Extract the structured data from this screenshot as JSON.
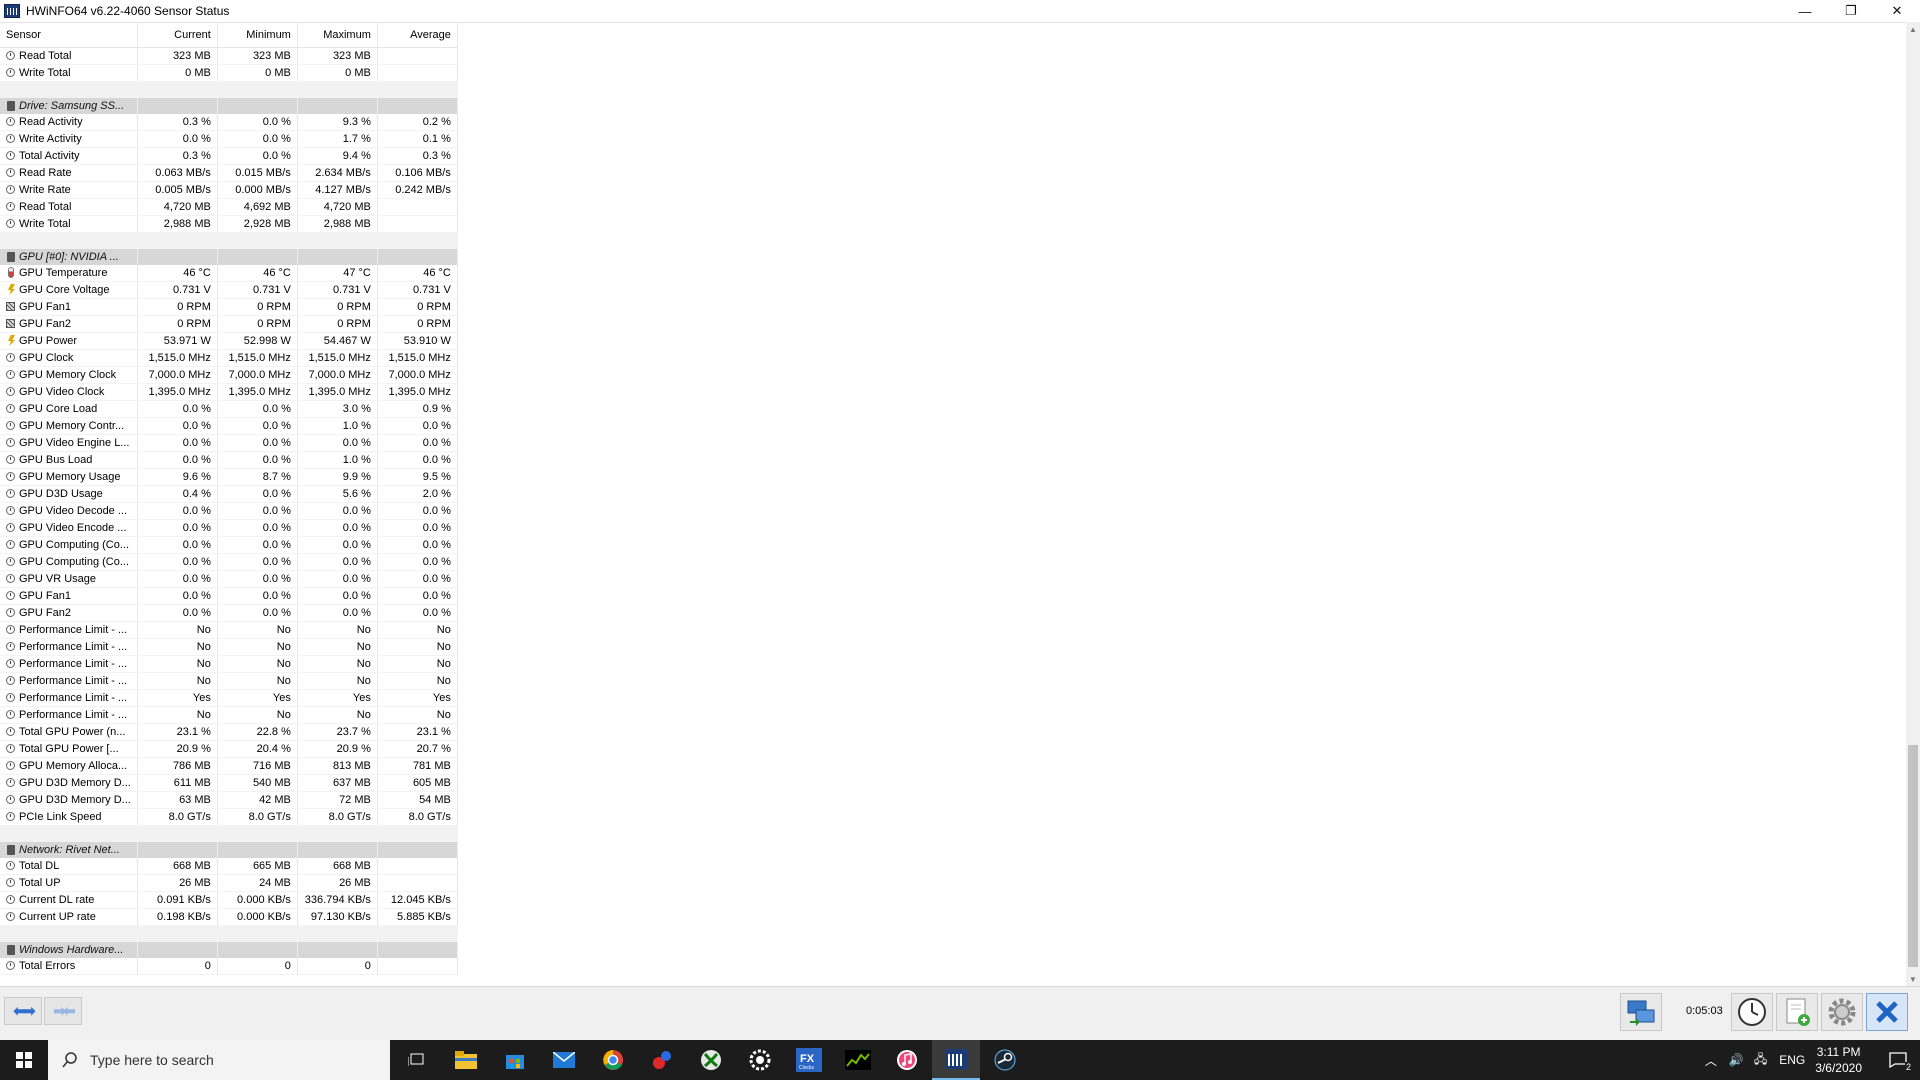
{
  "window": {
    "title": "HWiNFO64 v6.22-4060 Sensor Status",
    "minimize": "—",
    "restore": "❐",
    "close": "✕"
  },
  "columns": [
    "Sensor",
    "Current",
    "Minimum",
    "Maximum",
    "Average"
  ],
  "rows": [
    {
      "type": "sensor",
      "icon": "clock",
      "name": "Read Total",
      "cur": "323 MB",
      "min": "323 MB",
      "max": "323 MB",
      "avg": ""
    },
    {
      "type": "sensor",
      "icon": "clock",
      "name": "Write Total",
      "cur": "0 MB",
      "min": "0 MB",
      "max": "0 MB",
      "avg": ""
    },
    {
      "type": "blank"
    },
    {
      "type": "group",
      "icon": "drive",
      "name": "Drive: Samsung SS..."
    },
    {
      "type": "sensor",
      "icon": "clock",
      "name": "Read Activity",
      "cur": "0.3 %",
      "min": "0.0 %",
      "max": "9.3 %",
      "avg": "0.2 %"
    },
    {
      "type": "sensor",
      "icon": "clock",
      "name": "Write Activity",
      "cur": "0.0 %",
      "min": "0.0 %",
      "max": "1.7 %",
      "avg": "0.1 %"
    },
    {
      "type": "sensor",
      "icon": "clock",
      "name": "Total Activity",
      "cur": "0.3 %",
      "min": "0.0 %",
      "max": "9.4 %",
      "avg": "0.3 %"
    },
    {
      "type": "sensor",
      "icon": "clock",
      "name": "Read Rate",
      "cur": "0.063 MB/s",
      "min": "0.015 MB/s",
      "max": "2.634 MB/s",
      "avg": "0.106 MB/s"
    },
    {
      "type": "sensor",
      "icon": "clock",
      "name": "Write Rate",
      "cur": "0.005 MB/s",
      "min": "0.000 MB/s",
      "max": "4.127 MB/s",
      "avg": "0.242 MB/s"
    },
    {
      "type": "sensor",
      "icon": "clock",
      "name": "Read Total",
      "cur": "4,720 MB",
      "min": "4,692 MB",
      "max": "4,720 MB",
      "avg": ""
    },
    {
      "type": "sensor",
      "icon": "clock",
      "name": "Write Total",
      "cur": "2,988 MB",
      "min": "2,928 MB",
      "max": "2,988 MB",
      "avg": ""
    },
    {
      "type": "blank"
    },
    {
      "type": "group",
      "icon": "drive",
      "name": "GPU [#0]: NVIDIA ..."
    },
    {
      "type": "sensor",
      "icon": "therm",
      "name": "GPU Temperature",
      "cur": "46 °C",
      "min": "46 °C",
      "max": "47 °C",
      "avg": "46 °C"
    },
    {
      "type": "sensor",
      "icon": "bolt",
      "name": "GPU Core Voltage",
      "cur": "0.731 V",
      "min": "0.731 V",
      "max": "0.731 V",
      "avg": "0.731 V"
    },
    {
      "type": "sensor",
      "icon": "fan",
      "name": "GPU Fan1",
      "cur": "0 RPM",
      "min": "0 RPM",
      "max": "0 RPM",
      "avg": "0 RPM"
    },
    {
      "type": "sensor",
      "icon": "fan",
      "name": "GPU Fan2",
      "cur": "0 RPM",
      "min": "0 RPM",
      "max": "0 RPM",
      "avg": "0 RPM"
    },
    {
      "type": "sensor",
      "icon": "bolt",
      "name": "GPU Power",
      "cur": "53.971 W",
      "min": "52.998 W",
      "max": "54.467 W",
      "avg": "53.910 W"
    },
    {
      "type": "sensor",
      "icon": "clock",
      "name": "GPU Clock",
      "cur": "1,515.0 MHz",
      "min": "1,515.0 MHz",
      "max": "1,515.0 MHz",
      "avg": "1,515.0 MHz"
    },
    {
      "type": "sensor",
      "icon": "clock",
      "name": "GPU Memory Clock",
      "cur": "7,000.0 MHz",
      "min": "7,000.0 MHz",
      "max": "7,000.0 MHz",
      "avg": "7,000.0 MHz"
    },
    {
      "type": "sensor",
      "icon": "clock",
      "name": "GPU Video Clock",
      "cur": "1,395.0 MHz",
      "min": "1,395.0 MHz",
      "max": "1,395.0 MHz",
      "avg": "1,395.0 MHz"
    },
    {
      "type": "sensor",
      "icon": "clock",
      "name": "GPU Core Load",
      "cur": "0.0 %",
      "min": "0.0 %",
      "max": "3.0 %",
      "avg": "0.9 %"
    },
    {
      "type": "sensor",
      "icon": "clock",
      "name": "GPU Memory Contr...",
      "cur": "0.0 %",
      "min": "0.0 %",
      "max": "1.0 %",
      "avg": "0.0 %"
    },
    {
      "type": "sensor",
      "icon": "clock",
      "name": "GPU Video Engine L...",
      "cur": "0.0 %",
      "min": "0.0 %",
      "max": "0.0 %",
      "avg": "0.0 %"
    },
    {
      "type": "sensor",
      "icon": "clock",
      "name": "GPU Bus Load",
      "cur": "0.0 %",
      "min": "0.0 %",
      "max": "1.0 %",
      "avg": "0.0 %"
    },
    {
      "type": "sensor",
      "icon": "clock",
      "name": "GPU Memory Usage",
      "cur": "9.6 %",
      "min": "8.7 %",
      "max": "9.9 %",
      "avg": "9.5 %"
    },
    {
      "type": "sensor",
      "icon": "clock",
      "name": "GPU D3D Usage",
      "cur": "0.4 %",
      "min": "0.0 %",
      "max": "5.6 %",
      "avg": "2.0 %"
    },
    {
      "type": "sensor",
      "icon": "clock",
      "name": "GPU Video Decode ...",
      "cur": "0.0 %",
      "min": "0.0 %",
      "max": "0.0 %",
      "avg": "0.0 %"
    },
    {
      "type": "sensor",
      "icon": "clock",
      "name": "GPU Video Encode ...",
      "cur": "0.0 %",
      "min": "0.0 %",
      "max": "0.0 %",
      "avg": "0.0 %"
    },
    {
      "type": "sensor",
      "icon": "clock",
      "name": "GPU Computing (Co...",
      "cur": "0.0 %",
      "min": "0.0 %",
      "max": "0.0 %",
      "avg": "0.0 %"
    },
    {
      "type": "sensor",
      "icon": "clock",
      "name": "GPU Computing (Co...",
      "cur": "0.0 %",
      "min": "0.0 %",
      "max": "0.0 %",
      "avg": "0.0 %"
    },
    {
      "type": "sensor",
      "icon": "clock",
      "name": "GPU VR Usage",
      "cur": "0.0 %",
      "min": "0.0 %",
      "max": "0.0 %",
      "avg": "0.0 %"
    },
    {
      "type": "sensor",
      "icon": "clock",
      "name": "GPU Fan1",
      "cur": "0.0 %",
      "min": "0.0 %",
      "max": "0.0 %",
      "avg": "0.0 %"
    },
    {
      "type": "sensor",
      "icon": "clock",
      "name": "GPU Fan2",
      "cur": "0.0 %",
      "min": "0.0 %",
      "max": "0.0 %",
      "avg": "0.0 %"
    },
    {
      "type": "sensor",
      "icon": "clock",
      "name": "Performance Limit - ...",
      "cur": "No",
      "min": "No",
      "max": "No",
      "avg": "No"
    },
    {
      "type": "sensor",
      "icon": "clock",
      "name": "Performance Limit - ...",
      "cur": "No",
      "min": "No",
      "max": "No",
      "avg": "No"
    },
    {
      "type": "sensor",
      "icon": "clock",
      "name": "Performance Limit - ...",
      "cur": "No",
      "min": "No",
      "max": "No",
      "avg": "No"
    },
    {
      "type": "sensor",
      "icon": "clock",
      "name": "Performance Limit - ...",
      "cur": "No",
      "min": "No",
      "max": "No",
      "avg": "No"
    },
    {
      "type": "sensor",
      "icon": "clock",
      "name": "Performance Limit - ...",
      "cur": "Yes",
      "min": "Yes",
      "max": "Yes",
      "avg": "Yes"
    },
    {
      "type": "sensor",
      "icon": "clock",
      "name": "Performance Limit - ...",
      "cur": "No",
      "min": "No",
      "max": "No",
      "avg": "No"
    },
    {
      "type": "sensor",
      "icon": "clock",
      "name": "Total GPU Power (n...",
      "cur": "23.1 %",
      "min": "22.8 %",
      "max": "23.7 %",
      "avg": "23.1 %"
    },
    {
      "type": "sensor",
      "icon": "clock",
      "name": "Total GPU Power [...",
      "cur": "20.9 %",
      "min": "20.4 %",
      "max": "20.9 %",
      "avg": "20.7 %"
    },
    {
      "type": "sensor",
      "icon": "clock",
      "name": "GPU Memory Alloca...",
      "cur": "786 MB",
      "min": "716 MB",
      "max": "813 MB",
      "avg": "781 MB"
    },
    {
      "type": "sensor",
      "icon": "clock",
      "name": "GPU D3D Memory D...",
      "cur": "611 MB",
      "min": "540 MB",
      "max": "637 MB",
      "avg": "605 MB"
    },
    {
      "type": "sensor",
      "icon": "clock",
      "name": "GPU D3D Memory D...",
      "cur": "63 MB",
      "min": "42 MB",
      "max": "72 MB",
      "avg": "54 MB"
    },
    {
      "type": "sensor",
      "icon": "clock",
      "name": "PCIe Link Speed",
      "cur": "8.0 GT/s",
      "min": "8.0 GT/s",
      "max": "8.0 GT/s",
      "avg": "8.0 GT/s"
    },
    {
      "type": "blank"
    },
    {
      "type": "group",
      "icon": "drive",
      "name": "Network: Rivet Net..."
    },
    {
      "type": "sensor",
      "icon": "clock",
      "name": "Total DL",
      "cur": "668 MB",
      "min": "665 MB",
      "max": "668 MB",
      "avg": ""
    },
    {
      "type": "sensor",
      "icon": "clock",
      "name": "Total UP",
      "cur": "26 MB",
      "min": "24 MB",
      "max": "26 MB",
      "avg": ""
    },
    {
      "type": "sensor",
      "icon": "clock",
      "name": "Current DL rate",
      "cur": "0.091 KB/s",
      "min": "0.000 KB/s",
      "max": "336.794 KB/s",
      "avg": "12.045 KB/s"
    },
    {
      "type": "sensor",
      "icon": "clock",
      "name": "Current UP rate",
      "cur": "0.198 KB/s",
      "min": "0.000 KB/s",
      "max": "97.130 KB/s",
      "avg": "5.885 KB/s"
    },
    {
      "type": "blank"
    },
    {
      "type": "group",
      "icon": "drive",
      "name": "Windows Hardware..."
    },
    {
      "type": "sensor",
      "icon": "clock",
      "name": "Total Errors",
      "cur": "0",
      "min": "0",
      "max": "0",
      "avg": ""
    }
  ],
  "toolbar": {
    "timer": "0:05:03"
  },
  "taskbar": {
    "search_placeholder": "Type here to search",
    "apps": [
      "task-view",
      "file-explorer",
      "store",
      "mail",
      "chrome",
      "app-red-blue",
      "xbox",
      "steelseries",
      "fx-clocks",
      "nvidia",
      "itunes",
      "hwinfo",
      "steam"
    ],
    "language": "ENG",
    "time": "3:11 PM",
    "date": "3/6/2020",
    "notifications": "2"
  }
}
